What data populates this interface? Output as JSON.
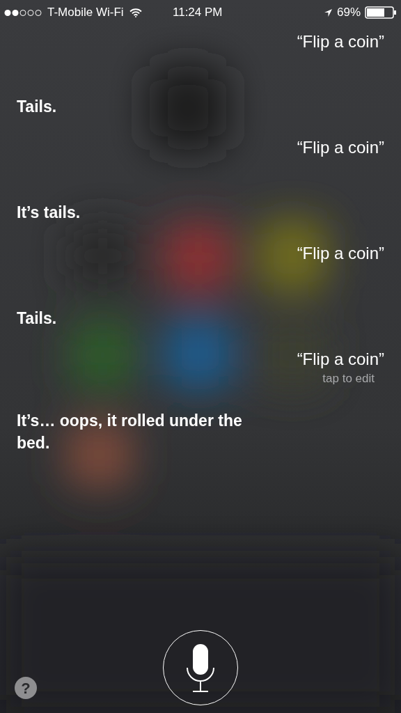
{
  "status_bar": {
    "carrier": "T-Mobile Wi-Fi",
    "time": "11:24 PM",
    "battery": "69%"
  },
  "conversation": [
    {
      "kind": "user",
      "text": "“Flip a coin”"
    },
    {
      "kind": "siri",
      "text": "Tails."
    },
    {
      "kind": "user",
      "text": "“Flip a coin”"
    },
    {
      "kind": "siri",
      "text": "It’s tails."
    },
    {
      "kind": "user",
      "text": "“Flip a coin”"
    },
    {
      "kind": "siri",
      "text": "Tails."
    },
    {
      "kind": "user",
      "text": "“Flip a coin”",
      "hint": "tap to edit"
    },
    {
      "kind": "siri",
      "text": "It’s… oops, it rolled under the bed."
    }
  ],
  "help_button": "?"
}
